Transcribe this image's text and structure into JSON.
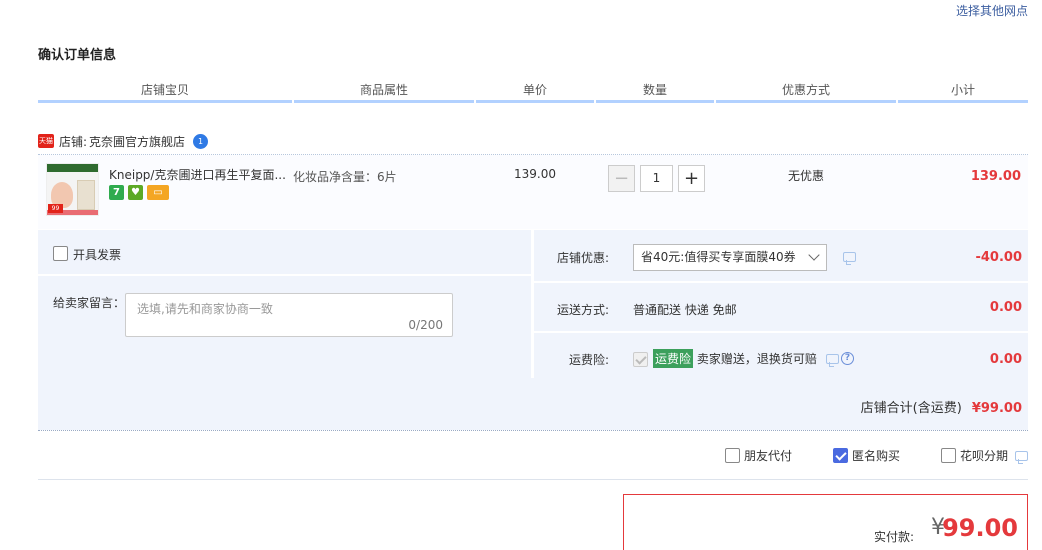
{
  "header": {
    "other_address_link": "选择其他网点",
    "page_title": "确认订单信息"
  },
  "table_header": {
    "columns": [
      "店铺宝贝",
      "商品属性",
      "单价",
      "数量",
      "优惠方式",
      "小计"
    ]
  },
  "shop": {
    "label": "店铺:",
    "name": "克奈圃官方旗舰店",
    "tmall_badge": "天猫",
    "wangwang_icon": "chat-bubble-icon"
  },
  "item": {
    "title": "Kneipp/克奈圃进口再生平复面...",
    "attribute": "化妆品净含量：6片",
    "unit_price": "139.00",
    "quantity": "1",
    "discount": "无优惠",
    "subtotal": "139.00",
    "service_icons": [
      "seven-day-return-icon",
      "guarantee-icon",
      "card-icon"
    ]
  },
  "invoice": {
    "label": "开具发票"
  },
  "memo": {
    "label": "给卖家留言：",
    "placeholder": "选填,请先和商家协商一致",
    "counter": "0/200"
  },
  "shop_discount": {
    "label": "店铺优惠:",
    "selected": "省40元:值得买专享面膜40券",
    "amount": "-40.00"
  },
  "shipping": {
    "label": "运送方式:",
    "value": "普通配送 快递 免邮",
    "amount": "0.00"
  },
  "insurance": {
    "label": "运费险:",
    "tag": "运费险",
    "text": "卖家赠送，退换货可赔",
    "help": "?",
    "amount": "0.00"
  },
  "shop_total": {
    "label": "店铺合计(含运费)",
    "amount": "¥99.00"
  },
  "options": {
    "friend_pay": "朋友代付",
    "anonymous": "匿名购买",
    "installment": "花呗分期"
  },
  "payment": {
    "label": "实付款:",
    "currency": "¥",
    "amount": "99.00"
  },
  "colors": {
    "accent_red": "#e4393c",
    "header_blue": "#b2d1ff",
    "section_bg": "#f0f4fc",
    "insurance_green": "#3ca05c"
  }
}
